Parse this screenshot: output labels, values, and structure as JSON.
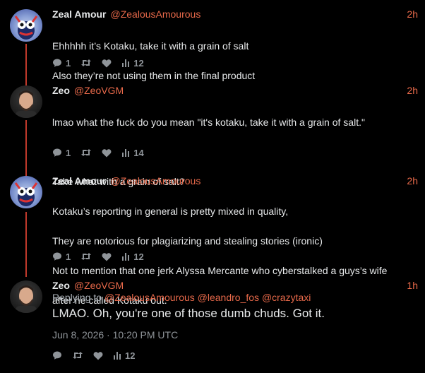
{
  "colors": {
    "background": "#000000",
    "accent": "#e8694a",
    "thread_line": "#c0392b",
    "text": "#e7e9ea",
    "muted": "#8f9499"
  },
  "tweets": [
    {
      "display_name": "Zeal Amour",
      "handle": "@ZealousAmourous",
      "time": "2h",
      "avatar": "zeal-amour-avatar",
      "lines": [
        "Ehhhhh it’s Kotaku, take it with a grain of salt",
        "Also they’re not using them in the final product"
      ],
      "replies": "1",
      "likes_views": "12"
    },
    {
      "display_name": "Zeo",
      "handle": "@ZeoVGM",
      "time": "2h",
      "avatar": "zeo-avatar",
      "lines": [
        "lmao what the fuck do you mean \"it's kotaku, take it with a grain of salt.\"",
        "",
        "Take what with a grain of salt?"
      ],
      "replies": "1",
      "likes_views": "14"
    },
    {
      "display_name": "Zeal Amour",
      "handle": "@ZealousAmourous",
      "time": "2h",
      "avatar": "zeal-amour-avatar",
      "lines": [
        "Kotaku’s reporting in general is pretty mixed in quality,",
        "They are notorious for plagiarizing and stealing stories (ironic)",
        "Not to mention that one jerk Alyssa Mercante who cyberstalked a guys’s wife",
        "after he called Kotaku out."
      ],
      "replies": "1",
      "likes_views": "12"
    },
    {
      "display_name": "Zeo",
      "handle": "@ZeoVGM",
      "time": "1h",
      "avatar": "zeo-avatar",
      "replying_prefix": "Replying to",
      "replying_mentions": [
        "@ZealousAmourous",
        "@leandro_fos",
        "@crazytaxi"
      ],
      "text": "LMAO. Oh, you're one of those dumb chuds. Got it.",
      "date": "Jun 8, 2026 · 10:20 PM UTC",
      "views": "12"
    }
  ]
}
